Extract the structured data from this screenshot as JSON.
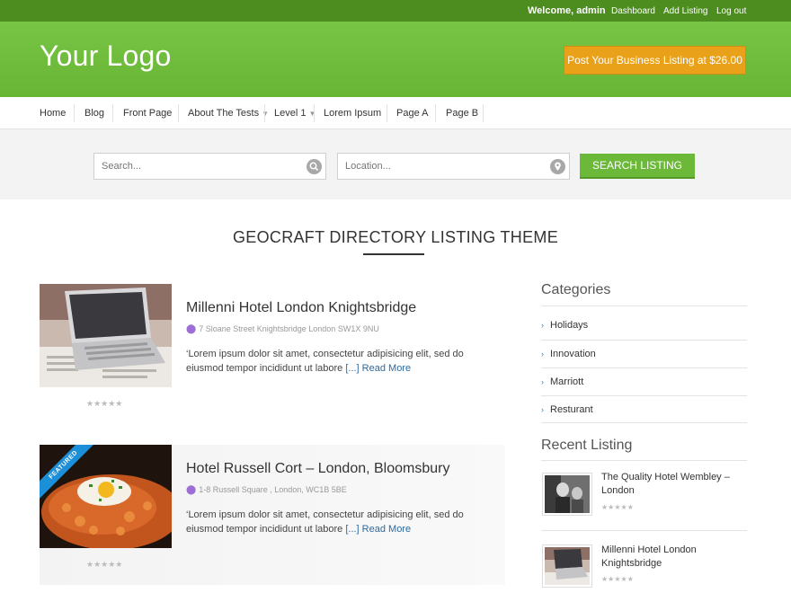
{
  "topbar": {
    "welcome": "Welcome, admin",
    "links": [
      "Dashboard",
      "Add Listing",
      "Log out"
    ]
  },
  "header": {
    "logo": "Your Logo",
    "post_button": "Post Your Business Listing at $26.00"
  },
  "nav": {
    "items": [
      "Home",
      "Blog",
      "Front Page",
      "About The Tests",
      "Level 1",
      "Lorem Ipsum",
      "Page A",
      "Page B"
    ]
  },
  "search": {
    "search_placeholder": "Search...",
    "location_placeholder": "Location...",
    "button": "SEARCH LISTING"
  },
  "page_title": "GEOCRAFT DIRECTORY LISTING THEME",
  "listings": [
    {
      "title": "Millenni Hotel London Knightsbridge",
      "address": "7 Sloane Street Knightsbridge London SW1X 9NU",
      "description": "‘Lorem ipsum dolor sit amet, consectetur adipisicing elit, sed do eiusmod tempor incididunt ut labore",
      "ellipsis": "[...]",
      "read_more": "Read More",
      "rating": "★★★★★",
      "featured": false
    },
    {
      "title": "Hotel Russell Cort – London, Bloomsbury",
      "address": "1-8 Russell Square , London, WC1B 5BE",
      "description": "‘Lorem ipsum dolor sit amet, consectetur adipisicing elit, sed do eiusmod tempor incididunt ut labore",
      "ellipsis": "[...]",
      "read_more": "Read More",
      "rating": "★★★★★",
      "featured": true,
      "badge": "FEATURED"
    }
  ],
  "sidebar": {
    "categories_title": "Categories",
    "categories": [
      "Holidays",
      "Innovation",
      "Marriott",
      "Resturant"
    ],
    "recent_title": "Recent Listing",
    "recent": [
      {
        "title": "The Quality Hotel Wembley – London",
        "rating": "★★★★★"
      },
      {
        "title": "Millenni Hotel London Knightsbridge",
        "rating": "★★★★★"
      }
    ]
  },
  "colors": {
    "header_green": "#6cb939",
    "topbar_green": "#4d8c1f",
    "post_button": "#e8a119",
    "link_blue": "#2c6aa0",
    "ribbon_blue": "#1b8fd8"
  }
}
